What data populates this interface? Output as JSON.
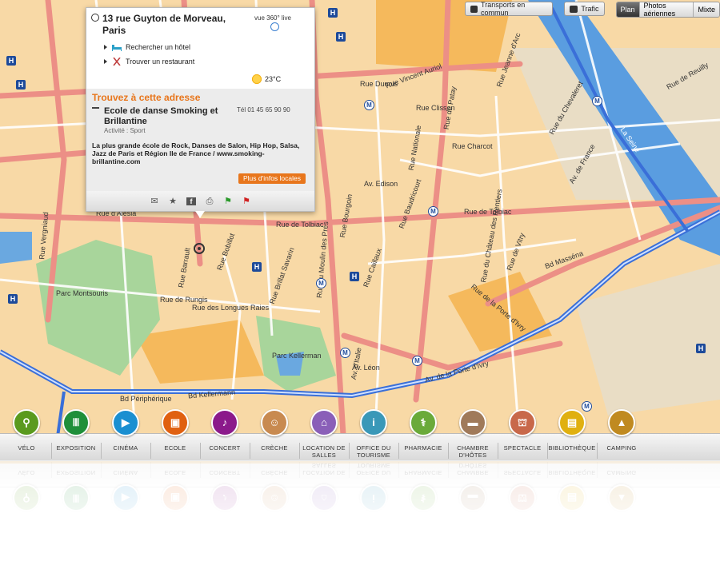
{
  "toolbar": {
    "transports_label": "Transports en commun",
    "trafic_label": "Trafic",
    "view_modes": [
      {
        "label": "Plan",
        "active": true
      },
      {
        "label": "Photos aériennes",
        "active": false
      },
      {
        "label": "Mixte",
        "active": false
      }
    ]
  },
  "popup": {
    "address": "13 rue Guyton de Morveau, Paris",
    "street_view_label": "vue 360° live",
    "links": [
      "Rechercher un hôtel",
      "Trouver un restaurant"
    ],
    "temperature": "23°C",
    "find_title": "Trouvez à cette adresse",
    "business_name": "Ecole de danse Smoking et Brillantine",
    "activity": "Activité : Sport",
    "tel": "Tél  01 45 65 90 90",
    "description": "La plus grande école de Rock, Danses de Salon, Hip Hop, Salsa, Jazz de Paris et Région Ile de France / www.smoking-brillantine.com",
    "more_button": "Plus d'infos locales",
    "action_icons": [
      "mail-icon",
      "star-icon",
      "facebook-icon",
      "print-icon",
      "green-flag-icon",
      "red-flag-icon"
    ]
  },
  "map_labels": [
    "Rue de Tolbiac",
    "Rue de Tolbiac",
    "Rue d'Alésia",
    "Av. Edison",
    "Rue Charcot",
    "Parc Montsouris",
    "Parc Kellerman",
    "La Seine",
    "Rue Clisson",
    "Rue Dunois",
    "Rue Nationale",
    "Rue Jeanne d'Arc",
    "Bd Masséna",
    "Av. de France",
    "Rue de Patay",
    "Rue du Chevaleret",
    "Rue Vergniaud",
    "Rue de Rungis",
    "Rue des Longues Raies",
    "Rue Barrault",
    "Bd Kellermann",
    "Av. d'Italie",
    "Rue Bobillot",
    "Rue Caillaux",
    "Rue du Moulin des Prés",
    "Rue Brillat Savarin",
    "Av. Léon",
    "Rue Baudricourt",
    "Rue du Château des Rentiers",
    "Rue Vincent Auriol",
    "Rue de Vitry",
    "Rue Bourgoin",
    "Rue de la Porte d'Ivry",
    "Av. de la Porte d'Ivry",
    "Bd Périphérique",
    "Rue de Reuilly"
  ],
  "categories": [
    {
      "label": "VÉLO",
      "color": "#5a9a1e",
      "icon": "bike-icon"
    },
    {
      "label": "EXPOSITION",
      "color": "#1f8f3a",
      "icon": "column-icon"
    },
    {
      "label": "CINÉMA",
      "color": "#1a8fd1",
      "icon": "clapper-icon"
    },
    {
      "label": "ECOLE",
      "color": "#e06010",
      "icon": "school-icon"
    },
    {
      "label": "CONCERT",
      "color": "#8b1a8b",
      "icon": "microphone-icon"
    },
    {
      "label": "CRÈCHE",
      "color": "#c88a50",
      "icon": "baby-icon"
    },
    {
      "label": "LOCATION DE SALLES",
      "color": "#8a5fb8",
      "icon": "building-icon"
    },
    {
      "label": "OFFICE DU TOURISME",
      "color": "#3a98b8",
      "icon": "info-icon"
    },
    {
      "label": "PHARMACIE",
      "color": "#6aaa3a",
      "icon": "caduceus-icon"
    },
    {
      "label": "CHAMBRE D'HÔTES",
      "color": "#a07a5a",
      "icon": "bed-icon"
    },
    {
      "label": "SPECTACLE",
      "color": "#c8684a",
      "icon": "theatre-icon"
    },
    {
      "label": "BIBLIOTHÈQUE",
      "color": "#e0b010",
      "icon": "book-icon"
    },
    {
      "label": "CAMPING",
      "color": "#c08a20",
      "icon": "tent-icon"
    }
  ]
}
